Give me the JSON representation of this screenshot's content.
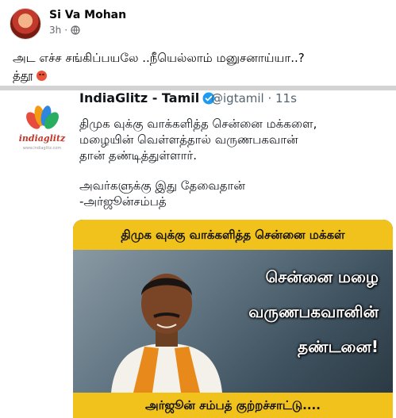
{
  "post": {
    "author": "Si Va Mohan",
    "time": "3h",
    "separator": "·",
    "text_line1": "அட எச்ச சங்கிப்பயலே ..நீயெல்லாம் மனுசனாய்யா..?",
    "text_line2": "த்தூ",
    "icons": [
      "globe-icon",
      "angry-face-emoji"
    ]
  },
  "shared_tweet": {
    "logo_text": "indiaglitz",
    "logo_subtext": "www.indiaglitz.com",
    "name": "IndiaGlitz - Tamil",
    "handle": "@igtamil · 11s",
    "lines": [
      "திமுக வுக்கு வாக்களித்த சென்னை மக்களை,",
      "மழையின் வெள்ளத்தால் வருணபகவான்",
      "தான் தண்டித்துள்ளார்.",
      "அவர்களுக்கு இது தேவைதான்",
      "-அர்ஜூன்சம்பத்"
    ],
    "card": {
      "banner": "திமுக வுக்கு வாக்களித்த சென்னை மக்கள்",
      "overlay_1": "சென்னை மழை",
      "overlay_2": "வருணபகவானின்",
      "overlay_3": "தண்டனை!",
      "footer": "அர்ஜூன் சம்பத் குற்றச்சாட்டு...."
    }
  },
  "colors": {
    "divider": "#d3d3d3",
    "banner_yellow": "#f1c21b",
    "verified_blue": "#1d9bf0",
    "secondary_text": "#65676b"
  }
}
